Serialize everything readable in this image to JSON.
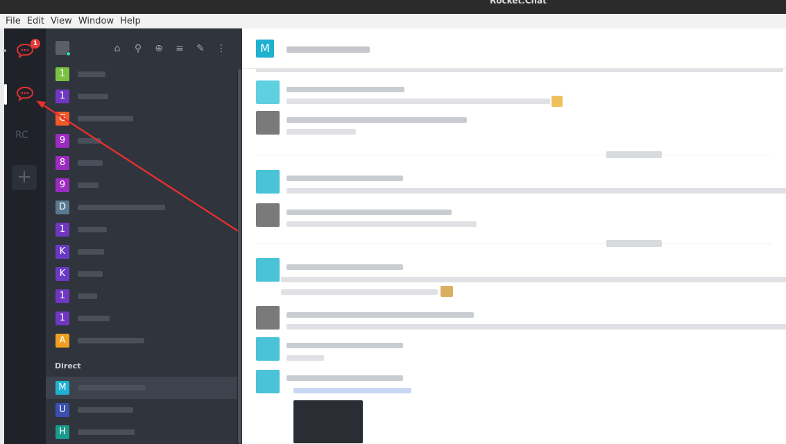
{
  "window": {
    "title": "Rocket.Chat"
  },
  "menu": [
    "File",
    "Edit",
    "View",
    "Window",
    "Help"
  ],
  "rail": {
    "badge": "1",
    "rc_label": "RC",
    "add_label": "+"
  },
  "sidebar": {
    "rooms": [
      {
        "letter": "1",
        "color": "#7cc143"
      },
      {
        "letter": "1",
        "color": "#7038c0"
      },
      {
        "letter": "G",
        "color": "#f05a28"
      },
      {
        "letter": "9",
        "color": "#9c2cc0"
      },
      {
        "letter": "8",
        "color": "#9c2cc0"
      },
      {
        "letter": "9",
        "color": "#9c2cc0"
      },
      {
        "letter": "D",
        "color": "#5b7a8f"
      },
      {
        "letter": "1",
        "color": "#7038c0"
      },
      {
        "letter": "K",
        "color": "#6a3ac4"
      },
      {
        "letter": "K",
        "color": "#6a3ac4"
      },
      {
        "letter": "1",
        "color": "#7038c0"
      },
      {
        "letter": "1",
        "color": "#7038c0"
      },
      {
        "letter": "A",
        "color": "#f0a020"
      }
    ],
    "direct_title": "Direct",
    "direct": [
      {
        "letter": "M",
        "color": "#20b0d0"
      },
      {
        "letter": "U",
        "color": "#3a4fb0"
      },
      {
        "letter": "H",
        "color": "#1a9a8a"
      }
    ]
  },
  "main": {
    "header_letter": "M",
    "header_color": "#20b0d0"
  },
  "colors": {
    "accent_red": "#e23030"
  }
}
